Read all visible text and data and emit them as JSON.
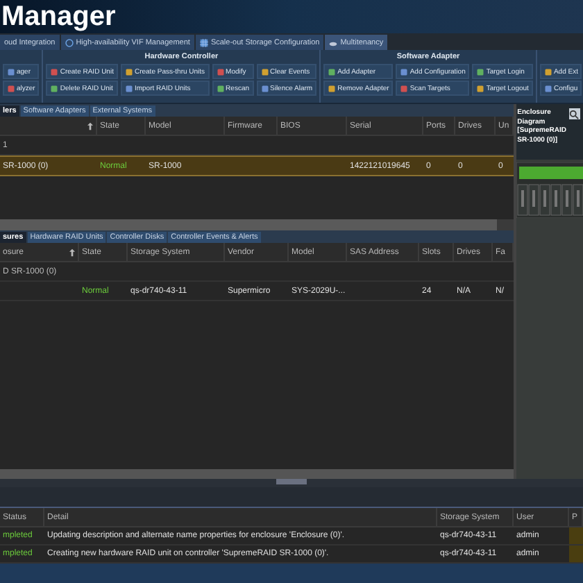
{
  "title": "Manager",
  "top_tabs": [
    {
      "label": "oud Integration",
      "selected": false
    },
    {
      "label": "High-availability VIF Management",
      "selected": false
    },
    {
      "label": "Scale-out Storage Configuration",
      "selected": false
    },
    {
      "label": "Multitenancy",
      "selected": true
    }
  ],
  "ribbon": [
    {
      "buttons": [
        {
          "label": "ager"
        },
        {
          "label": "alyzer"
        }
      ]
    },
    {
      "title": "Hardware Controller",
      "buttons": [
        {
          "label": "Create RAID Unit"
        },
        {
          "label": "Delete RAID Unit"
        },
        {
          "label": "Create Pass-thru Units"
        },
        {
          "label": "Import RAID Units"
        },
        {
          "label": "Modify"
        },
        {
          "label": "Rescan"
        },
        {
          "label": "Clear Events"
        },
        {
          "label": "Silence Alarm"
        }
      ]
    },
    {
      "title": "Software Adapter",
      "buttons": [
        {
          "label": "Add Adapter"
        },
        {
          "label": "Remove Adapter"
        },
        {
          "label": "Add Configuration"
        },
        {
          "label": "Scan Targets"
        },
        {
          "label": "Target Login"
        },
        {
          "label": "Target Logout"
        }
      ]
    },
    {
      "buttons": [
        {
          "label": "Add Ext"
        },
        {
          "label": "Configu"
        }
      ]
    }
  ],
  "upper_tabs": [
    {
      "label": "lers",
      "selected": true
    },
    {
      "label": "Software Adapters",
      "selected": false
    },
    {
      "label": "External Systems",
      "selected": false
    }
  ],
  "upper_table": {
    "columns": [
      {
        "kind": "sort"
      },
      {
        "label": "State",
        "kind": "state"
      },
      {
        "label": "Model",
        "kind": "text"
      },
      {
        "label": "Firmware",
        "kind": "text"
      },
      {
        "label": "BIOS",
        "kind": "text"
      },
      {
        "label": "Serial",
        "kind": "text"
      },
      {
        "label": "Ports",
        "kind": "text"
      },
      {
        "label": "Drives",
        "kind": "text"
      },
      {
        "label": "Un",
        "kind": "text"
      }
    ],
    "group": "1",
    "rows": [
      {
        "selected": true,
        "cells": [
          "SR-1000 (0)",
          "Normal",
          "SR-1000",
          "",
          "",
          "1422121019645",
          "0",
          "0",
          "0"
        ]
      }
    ]
  },
  "lower_tabs": [
    {
      "label": "sures",
      "selected": true
    },
    {
      "label": "Hardware RAID Units",
      "selected": false
    },
    {
      "label": "Controller Disks",
      "selected": false
    },
    {
      "label": "Controller Events & Alerts",
      "selected": false
    }
  ],
  "lower_table": {
    "columns": [
      {
        "label": "osure",
        "kind": "sort"
      },
      {
        "label": "State",
        "kind": "state"
      },
      {
        "label": "Storage System",
        "kind": "text"
      },
      {
        "label": "Vendor",
        "kind": "text"
      },
      {
        "label": "Model",
        "kind": "text"
      },
      {
        "label": "SAS Address",
        "kind": "text"
      },
      {
        "label": "Slots",
        "kind": "text"
      },
      {
        "label": "Drives",
        "kind": "text"
      },
      {
        "label": "Fa",
        "kind": "text"
      }
    ],
    "group": "D SR-1000 (0)",
    "rows": [
      {
        "selected": false,
        "cells": [
          "",
          "Normal",
          "qs-dr740-43-11",
          "Supermicro",
          "SYS-2029U-...",
          "",
          "24",
          "N/A",
          "N/"
        ]
      }
    ]
  },
  "enclosure": {
    "title": "Enclosure Diagram [SupremeRAID SR-1000 (0)]"
  },
  "tasks": {
    "columns": [
      {
        "label": "Status",
        "kind": "state"
      },
      {
        "label": "Detail",
        "kind": "text"
      },
      {
        "label": "Storage System",
        "kind": "text"
      },
      {
        "label": "User",
        "kind": "text"
      },
      {
        "label": "P",
        "kind": "text"
      }
    ],
    "rows": [
      {
        "selected": false,
        "cells": [
          "mpleted",
          "Updating description and alternate name properties for enclosure 'Enclosure (0)'.",
          "qs-dr740-43-11",
          "admin",
          ""
        ]
      },
      {
        "selected": false,
        "cells": [
          "mpleted",
          "Creating new hardware RAID unit on controller 'SupremeRAID SR-1000 (0)'.",
          "qs-dr740-43-11",
          "admin",
          ""
        ]
      }
    ]
  }
}
